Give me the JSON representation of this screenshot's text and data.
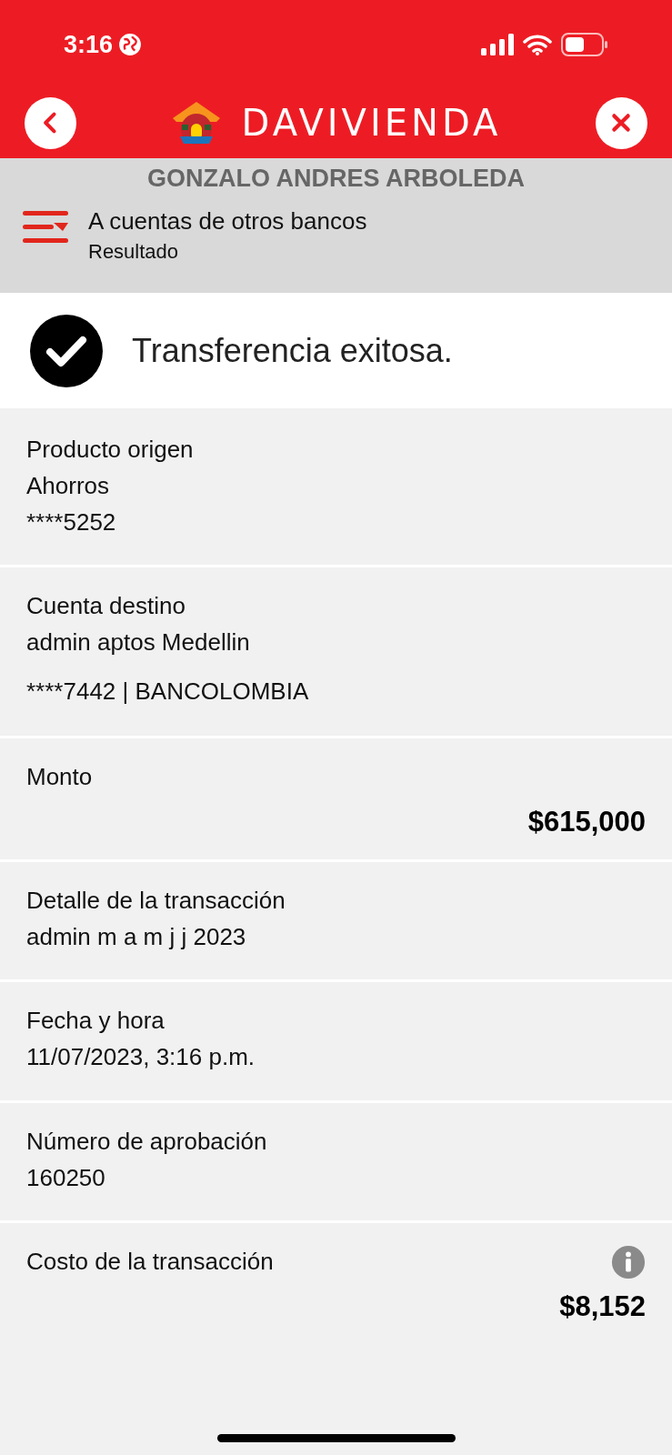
{
  "status_bar": {
    "time": "3:16"
  },
  "header": {
    "logo_text": "DAVIVIENDA"
  },
  "user": {
    "name": "GONZALO ANDRES ARBOLEDA",
    "section": "A cuentas de otros bancos",
    "subsection": "Resultado"
  },
  "result": {
    "message": "Transferencia exitosa."
  },
  "rows": [
    {
      "kind": "lines",
      "label": "Producto origen",
      "lines": [
        "Ahorros",
        "****5252"
      ],
      "info": false
    },
    {
      "kind": "lines",
      "label": "Cuenta destino",
      "lines": [
        "admin aptos Medellin",
        "****7442 | BANCOLOMBIA"
      ],
      "info": false
    },
    {
      "kind": "amount",
      "label": "Monto",
      "amount": "$615,000",
      "info": false
    },
    {
      "kind": "lines",
      "label": "Detalle de la transacción",
      "lines": [
        "admin m a m j j 2023"
      ],
      "info": false
    },
    {
      "kind": "lines",
      "label": "Fecha y hora",
      "lines": [
        "11/07/2023, 3:16 p.m."
      ],
      "info": false
    },
    {
      "kind": "lines",
      "label": "Número de aprobación",
      "lines": [
        "160250"
      ],
      "info": false
    },
    {
      "kind": "amount",
      "label": "Costo de la transacción",
      "amount": "$8,152",
      "info": true
    }
  ]
}
